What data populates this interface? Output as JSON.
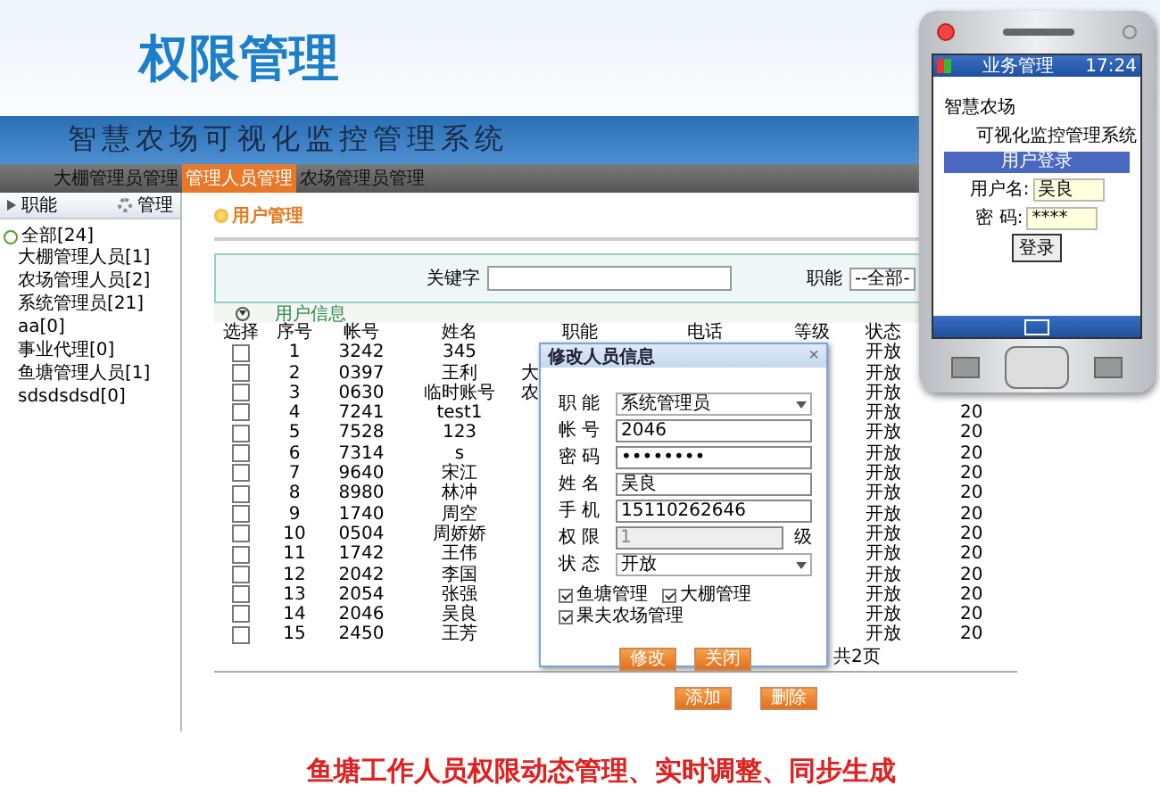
{
  "slide_title": "权限管理",
  "app": {
    "system_title": "智慧农场可视化监控管理系统",
    "nav": [
      {
        "label": "大棚管理员管理",
        "selected": false
      },
      {
        "label": "管理人员管理",
        "selected": true
      },
      {
        "label": "农场管理员管理",
        "selected": false
      }
    ],
    "sidebar": {
      "header": "职能",
      "manage": "管理",
      "tree": [
        {
          "label": "全部[24]",
          "children": [
            {
              "label": "大棚管理人员[1]"
            },
            {
              "label": "农场管理人员[2]"
            },
            {
              "label": "系统管理员[21]"
            },
            {
              "label": "aa[0]"
            },
            {
              "label": "事业代理[0]"
            },
            {
              "label": "鱼塘管理人员[1]"
            },
            {
              "label": "sdsdsdsd[0]"
            }
          ]
        }
      ]
    },
    "page_title": "用户管理",
    "search": {
      "keyword_label": "关键字",
      "role_label": "职能",
      "role_value": "--全部-"
    },
    "section_title": "用户信息",
    "table": {
      "columns": [
        "选择",
        "序号",
        "帐号",
        "姓名",
        "职能",
        "电话",
        "等级",
        "状态"
      ],
      "rows": [
        {
          "checked": false,
          "seq": "1",
          "account": "3242",
          "name": "345",
          "status": "开放"
        },
        {
          "checked": false,
          "seq": "2",
          "account": "0397",
          "name": "王利",
          "role": "大",
          "status": "开放"
        },
        {
          "checked": false,
          "seq": "3",
          "account": "0630",
          "name": "临时账号",
          "role": "农",
          "status": "开放"
        },
        {
          "checked": false,
          "seq": "4",
          "account": "7241",
          "name": "test1",
          "status": "开放",
          "column_9": "20"
        },
        {
          "checked": false,
          "seq": "5",
          "account": "7528",
          "name": "123",
          "status": "开放",
          "column_9": "20"
        },
        {
          "checked": false,
          "seq": "6",
          "account": "7314",
          "name": "s",
          "status": "开放",
          "column_9": "20"
        },
        {
          "checked": false,
          "seq": "7",
          "account": "9640",
          "name": "宋江",
          "status": "开放",
          "column_9": "20"
        },
        {
          "checked": false,
          "seq": "8",
          "account": "8980",
          "name": "林冲",
          "status": "开放",
          "column_9": "20"
        },
        {
          "checked": false,
          "seq": "9",
          "account": "1740",
          "name": "周空",
          "status": "开放",
          "column_9": "20"
        },
        {
          "checked": false,
          "seq": "10",
          "account": "0504",
          "name": "周娇娇",
          "status": "开放",
          "column_9": "20"
        },
        {
          "checked": false,
          "seq": "11",
          "account": "1742",
          "name": "王伟",
          "status": "开放",
          "column_9": "20"
        },
        {
          "checked": false,
          "seq": "12",
          "account": "2042",
          "name": "李国",
          "status": "开放",
          "column_9": "20"
        },
        {
          "checked": false,
          "seq": "13",
          "account": "2054",
          "name": "张强",
          "status": "开放",
          "column_9": "20"
        },
        {
          "checked": false,
          "seq": "14",
          "account": "2046",
          "name": "吴良",
          "status": "开放",
          "column_9": "20"
        },
        {
          "checked": false,
          "seq": "15",
          "account": "2450",
          "name": "王芳",
          "status": "开放",
          "column_9": "20"
        }
      ],
      "pages": "共2页"
    },
    "buttons": [
      "添加",
      "删除"
    ],
    "dialog": {
      "title": "修改人员信息",
      "close": "×",
      "fields": [
        {
          "label": "职 能",
          "kind": "select",
          "value": "系统管理员"
        },
        {
          "label": "帐 号",
          "kind": "text",
          "value": "2046"
        },
        {
          "label": "密 码",
          "kind": "password",
          "value": "••••••••"
        },
        {
          "label": "姓 名",
          "kind": "text",
          "value": "吴良"
        },
        {
          "label": "手 机",
          "kind": "text",
          "value": "15110262646"
        },
        {
          "label": "权 限",
          "kind": "level",
          "value": "1",
          "suffix": "级"
        },
        {
          "label": "状 态",
          "kind": "select",
          "value": "开放"
        }
      ],
      "permissions": [
        {
          "label": "鱼塘管理",
          "checked": true
        },
        {
          "label": "大棚管理",
          "checked": true
        },
        {
          "label": "果夫农场管理",
          "checked": true
        }
      ],
      "buttons": [
        "修改",
        "关闭"
      ]
    }
  },
  "phone": {
    "app_name": "业务管理",
    "time": "17:24",
    "title_line_1": "智慧农场",
    "title_line_2": "可视化监控管理系统",
    "login_header": "用户登录",
    "username_label": "用户名:",
    "username": "吴良",
    "password_label": "密 码:",
    "password": "****",
    "login_button": "登录"
  },
  "caption": "鱼塘工作人员权限动态管理、实时调整、同步生成"
}
